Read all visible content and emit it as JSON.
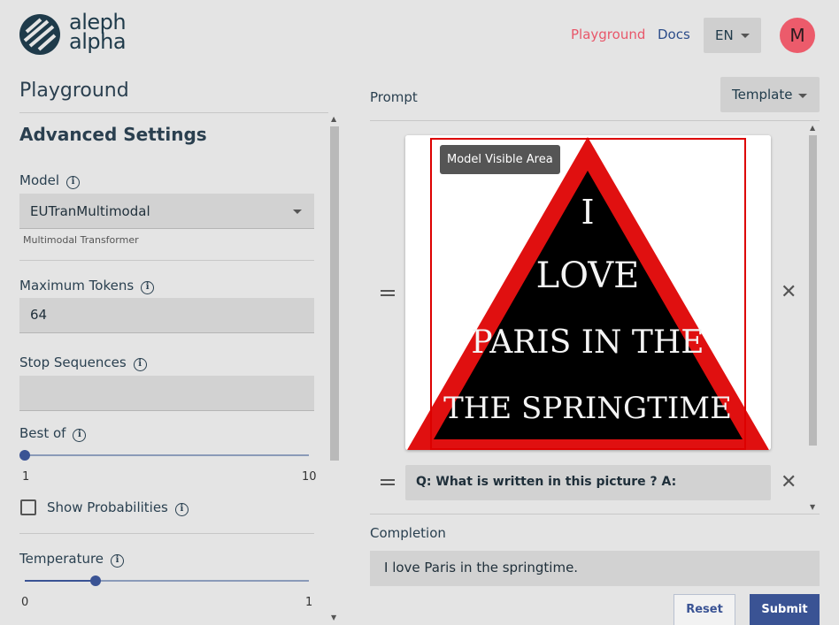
{
  "header": {
    "logo_line1": "aleph",
    "logo_line2": "alpha",
    "nav": {
      "playground": "Playground",
      "docs": "Docs"
    },
    "language": "EN",
    "avatar_initial": "M"
  },
  "sidebar": {
    "page_title": "Playground",
    "section_title": "Advanced Settings",
    "model": {
      "label": "Model",
      "value": "EUTranMultimodal",
      "helper": "Multimodal Transformer"
    },
    "max_tokens": {
      "label": "Maximum Tokens",
      "value": "64"
    },
    "stop_sequences": {
      "label": "Stop Sequences",
      "value": ""
    },
    "best_of": {
      "label": "Best of",
      "min": "1",
      "max": "10",
      "value": 1
    },
    "show_probabilities": {
      "label": "Show Probabilities",
      "checked": false
    },
    "temperature": {
      "label": "Temperature",
      "min": "0",
      "max": "1",
      "value": 0.25
    }
  },
  "prompt": {
    "title": "Prompt",
    "template_label": "Template",
    "image_tooltip": "Model Visible Area",
    "image_text_lines": [
      "I",
      "LOVE",
      "PARIS IN THE",
      "THE SPRINGTIME"
    ],
    "text_item": "Q: What is written in this picture ? A:"
  },
  "completion": {
    "title": "Completion",
    "value": "I love Paris in the springtime.",
    "reset_label": "Reset",
    "submit_label": "Submit"
  },
  "colors": {
    "accent": "#3a5394",
    "brand_pink": "#e8576a",
    "background": "#e4e4e4"
  }
}
